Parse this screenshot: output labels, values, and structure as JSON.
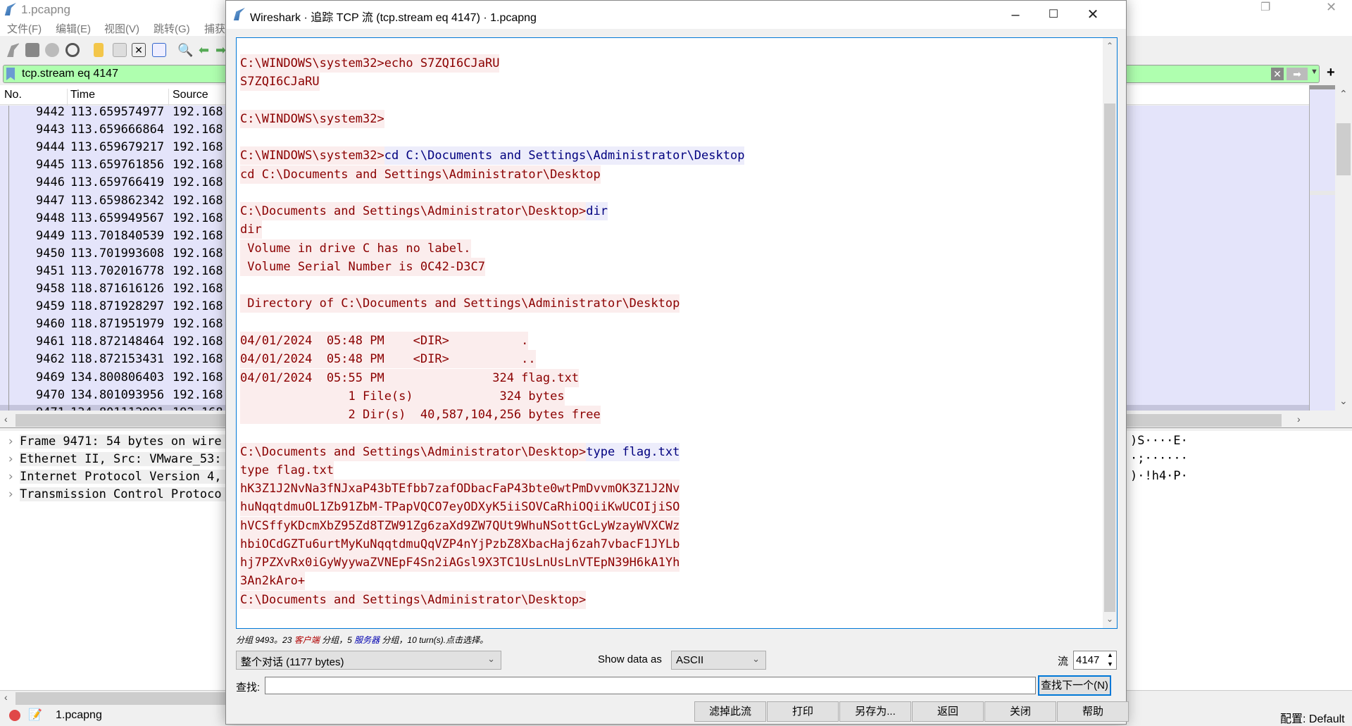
{
  "main": {
    "title": "1.pcapng",
    "menu": [
      "文件(F)",
      "编辑(E)",
      "视图(V)",
      "跳转(G)",
      "捕获"
    ],
    "filter": "tcp.stream eq 4147",
    "columns": [
      "No.",
      "Time",
      "Source"
    ],
    "packets": [
      {
        "no": "9442",
        "time": "113.659574977",
        "src": "192.168"
      },
      {
        "no": "9443",
        "time": "113.659666864",
        "src": "192.168"
      },
      {
        "no": "9444",
        "time": "113.659679217",
        "src": "192.168"
      },
      {
        "no": "9445",
        "time": "113.659761856",
        "src": "192.168"
      },
      {
        "no": "9446",
        "time": "113.659766419",
        "src": "192.168"
      },
      {
        "no": "9447",
        "time": "113.659862342",
        "src": "192.168"
      },
      {
        "no": "9448",
        "time": "113.659949567",
        "src": "192.168"
      },
      {
        "no": "9449",
        "time": "113.701840539",
        "src": "192.168"
      },
      {
        "no": "9450",
        "time": "113.701993608",
        "src": "192.168"
      },
      {
        "no": "9451",
        "time": "113.702016778",
        "src": "192.168"
      },
      {
        "no": "9458",
        "time": "118.871616126",
        "src": "192.168"
      },
      {
        "no": "9459",
        "time": "118.871928297",
        "src": "192.168"
      },
      {
        "no": "9460",
        "time": "118.871951979",
        "src": "192.168"
      },
      {
        "no": "9461",
        "time": "118.872148464",
        "src": "192.168"
      },
      {
        "no": "9462",
        "time": "118.872153431",
        "src": "192.168"
      },
      {
        "no": "9469",
        "time": "134.800806403",
        "src": "192.168"
      },
      {
        "no": "9470",
        "time": "134.801093956",
        "src": "192.168"
      },
      {
        "no": "9471",
        "time": "134.801112991",
        "src": "192.168"
      }
    ],
    "details": [
      "Frame 9471: 54 bytes on wire",
      "Ethernet II, Src: VMware_53:",
      "Internet Protocol Version 4,",
      "Transmission Control Protoco"
    ],
    "hex_ascii": [
      ")S····E·",
      "·;······",
      ")·!h4·P·"
    ],
    "status_file": "1.pcapng",
    "profile": "配置: Default"
  },
  "dialog": {
    "title": "Wireshark · 追踪 TCP 流 (tcp.stream eq 4147) · 1.pcapng",
    "stream_lines": [
      [
        {
          "t": "C:\\WINDOWS\\system32>echo S7ZQI6CJaRU",
          "d": "c"
        }
      ],
      [
        {
          "t": "S7ZQI6CJaRU",
          "d": "c"
        }
      ],
      [],
      [
        {
          "t": "C:\\WINDOWS\\system32>",
          "d": "c"
        }
      ],
      [],
      [
        {
          "t": "C:\\WINDOWS\\system32>",
          "d": "c"
        },
        {
          "t": "cd C:\\Documents and Settings\\Administrator\\Desktop",
          "d": "s"
        }
      ],
      [
        {
          "t": "cd C:\\Documents and Settings\\Administrator\\Desktop",
          "d": "c"
        }
      ],
      [],
      [
        {
          "t": "C:\\Documents and Settings\\Administrator\\Desktop>",
          "d": "c"
        },
        {
          "t": "dir",
          "d": "s"
        }
      ],
      [
        {
          "t": "dir",
          "d": "c"
        }
      ],
      [
        {
          "t": " Volume in drive C has no label.",
          "d": "c"
        }
      ],
      [
        {
          "t": " Volume Serial Number is 0C42-D3C7",
          "d": "c"
        }
      ],
      [],
      [
        {
          "t": " Directory of C:\\Documents and Settings\\Administrator\\Desktop",
          "d": "c"
        }
      ],
      [],
      [
        {
          "t": "04/01/2024  05:48 PM    <DIR>          .",
          "d": "c"
        }
      ],
      [
        {
          "t": "04/01/2024  05:48 PM    <DIR>          ..",
          "d": "c"
        }
      ],
      [
        {
          "t": "04/01/2024  05:55 PM               324 flag.txt",
          "d": "c"
        }
      ],
      [
        {
          "t": "               1 File(s)            324 bytes",
          "d": "c"
        }
      ],
      [
        {
          "t": "               2 Dir(s)  40,587,104,256 bytes free",
          "d": "c"
        }
      ],
      [],
      [
        {
          "t": "C:\\Documents and Settings\\Administrator\\Desktop>",
          "d": "c"
        },
        {
          "t": "type flag.txt",
          "d": "s"
        }
      ],
      [
        {
          "t": "type flag.txt",
          "d": "c"
        }
      ],
      [
        {
          "t": "hK3Z1J2NvNa3fNJxaP43bTEfbb7zafODbacFaP43bte0wtPmDvvmOK3Z1J2Nv",
          "d": "c"
        }
      ],
      [
        {
          "t": "huNqqtdmuOL1Zb91ZbM-TPapVQCO7eyODXyK5iiSOVCaRhiOQiiKwUCOIjiSO",
          "d": "c"
        }
      ],
      [
        {
          "t": "hVCSffyKDcmXbZ95Zd8TZW91Zg6zaXd9ZW7QUt9WhuNSottGcLyWzayWVXCWz",
          "d": "c"
        }
      ],
      [
        {
          "t": "hbiOCdGZTu6urtMyKuNqqtdmuQqVZP4nYjPzbZ8XbacHaj6zah7vbacF1JYLb",
          "d": "c"
        }
      ],
      [
        {
          "t": "hj7PZXvRx0iGyWyywaZVNEpF4Sn2iAGsl9X3TC1UsLnUsLnVTEpN39H6kA1Yh",
          "d": "c"
        }
      ],
      [
        {
          "t": "3An2kAro+",
          "d": "c"
        }
      ],
      [
        {
          "t": "C:\\Documents and Settings\\Administrator\\Desktop>",
          "d": "c"
        }
      ]
    ],
    "status": {
      "p1": "分组 9493。23 ",
      "client": "客户端",
      "p2": " 分组，5 ",
      "server": "服务器",
      "p3": " 分组，10 turn(s).点击选择。"
    },
    "conversation": "整个对话 (1177 bytes)",
    "show_as_label": "Show data as",
    "show_as": "ASCII",
    "stream_label": "流",
    "stream_no": "4147",
    "find_label": "查找:",
    "find_value": "",
    "find_next": "查找下一个(N)",
    "buttons": [
      "滤掉此流",
      "打印",
      "另存为...",
      "返回",
      "关闭",
      "帮助"
    ],
    "colors": {
      "client_fg": "#8b0000",
      "client_bg": "#fbeded",
      "server_fg": "#00007f",
      "server_bg": "#ededfb",
      "filter_ok": "#afffaf"
    }
  }
}
